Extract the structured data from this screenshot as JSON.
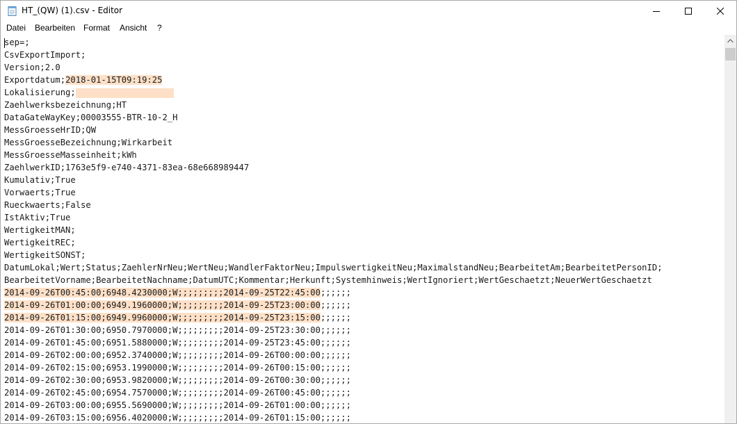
{
  "window": {
    "title": "HT_(QW) (1).csv - Editor",
    "icon": "notepad-icon"
  },
  "menu": [
    {
      "label": "Datei"
    },
    {
      "label": "Bearbeiten"
    },
    {
      "label": "Format"
    },
    {
      "label": "Ansicht"
    },
    {
      "label": "?"
    }
  ],
  "highlight_color": "#fde0c7",
  "editor": {
    "lines": [
      {
        "segments": [
          {
            "text": "sep=;"
          }
        ]
      },
      {
        "segments": [
          {
            "text": "CsvExportImport;"
          }
        ]
      },
      {
        "segments": [
          {
            "text": "Version;2.0"
          }
        ]
      },
      {
        "segments": [
          {
            "text": "Exportdatum;"
          },
          {
            "text": "2018-01-15T09:19:25",
            "hl": true
          }
        ]
      },
      {
        "segments": [
          {
            "text": "Lokalisierung;"
          },
          {
            "text": "",
            "hl_blank": true
          }
        ]
      },
      {
        "segments": [
          {
            "text": "Zaehlwerksbezeichnung;HT"
          }
        ]
      },
      {
        "segments": [
          {
            "text": "DataGateWayKey;00003555-BTR-10-2_H"
          }
        ]
      },
      {
        "segments": [
          {
            "text": "MessGroesseHrID;QW"
          }
        ]
      },
      {
        "segments": [
          {
            "text": "MessGroesseBezeichnung;Wirkarbeit"
          }
        ]
      },
      {
        "segments": [
          {
            "text": "MessGroesseMasseinheit;kWh"
          }
        ]
      },
      {
        "segments": [
          {
            "text": "ZaehlwerkID;1763e5f9-e740-4371-83ea-68e668989447"
          }
        ]
      },
      {
        "segments": [
          {
            "text": "Kumulativ;True"
          }
        ]
      },
      {
        "segments": [
          {
            "text": "Vorwaerts;True"
          }
        ]
      },
      {
        "segments": [
          {
            "text": "Rueckwaerts;False"
          }
        ]
      },
      {
        "segments": [
          {
            "text": "IstAktiv;True"
          }
        ]
      },
      {
        "segments": [
          {
            "text": "WertigkeitMAN;"
          }
        ]
      },
      {
        "segments": [
          {
            "text": "WertigkeitREC;"
          }
        ]
      },
      {
        "segments": [
          {
            "text": "WertigkeitSONST;"
          }
        ]
      },
      {
        "segments": [
          {
            "text": "DatumLokal;Wert;Status;ZaehlerNrNeu;WertNeu;WandlerFaktorNeu;ImpulswertigkeitNeu;MaximalstandNeu;BearbeitetAm;BearbeitetPersonID;"
          }
        ]
      },
      {
        "segments": [
          {
            "text": "BearbeitetVorname;BearbeitetNachname;DatumUTC;Kommentar;Herkunft;Systemhinweis;WertIgnoriert;WertGeschaetzt;NeuerWertGeschaetzt"
          }
        ]
      },
      {
        "segments": [
          {
            "text": "2014-09-26T00:45:00;6948.4230000;W;;;;;;;;;",
            "hl": true
          },
          {
            "text": "2014-09-25T22:45:00",
            "hl": true
          },
          {
            "text": ";;;;;;"
          }
        ]
      },
      {
        "segments": [
          {
            "text": "2014-09-26T01:00:00;6949.1960000;W;;;;;;;;;",
            "hl": true
          },
          {
            "text": "2014-09-25T23:00:00",
            "hl": true
          },
          {
            "text": ";;;;;;"
          }
        ]
      },
      {
        "segments": [
          {
            "text": "2014-09-26T01:15:00;6949.9960000;W;;;;;;;;;",
            "hl": true
          },
          {
            "text": "2014-09-25T23:15:00",
            "hl": true
          },
          {
            "text": ";;;;;;"
          }
        ]
      },
      {
        "segments": [
          {
            "text": "2014-09-26T01:30:00;6950.7970000;W;;;;;;;;;2014-09-25T23:30:00;;;;;;"
          }
        ]
      },
      {
        "segments": [
          {
            "text": "2014-09-26T01:45:00;6951.5880000;W;;;;;;;;;2014-09-25T23:45:00;;;;;;"
          }
        ]
      },
      {
        "segments": [
          {
            "text": "2014-09-26T02:00:00;6952.3740000;W;;;;;;;;;2014-09-26T00:00:00;;;;;;"
          }
        ]
      },
      {
        "segments": [
          {
            "text": "2014-09-26T02:15:00;6953.1990000;W;;;;;;;;;2014-09-26T00:15:00;;;;;;"
          }
        ]
      },
      {
        "segments": [
          {
            "text": "2014-09-26T02:30:00;6953.9820000;W;;;;;;;;;2014-09-26T00:30:00;;;;;;"
          }
        ]
      },
      {
        "segments": [
          {
            "text": "2014-09-26T02:45:00;6954.7570000;W;;;;;;;;;2014-09-26T00:45:00;;;;;;"
          }
        ]
      },
      {
        "segments": [
          {
            "text": "2014-09-26T03:00:00;6955.5690000;W;;;;;;;;;2014-09-26T01:00:00;;;;;;"
          }
        ]
      },
      {
        "segments": [
          {
            "text": "2014-09-26T03:15:00;6956.4020000;W;;;;;;;;;2014-09-26T01:15:00;;;;;;"
          }
        ]
      }
    ]
  }
}
